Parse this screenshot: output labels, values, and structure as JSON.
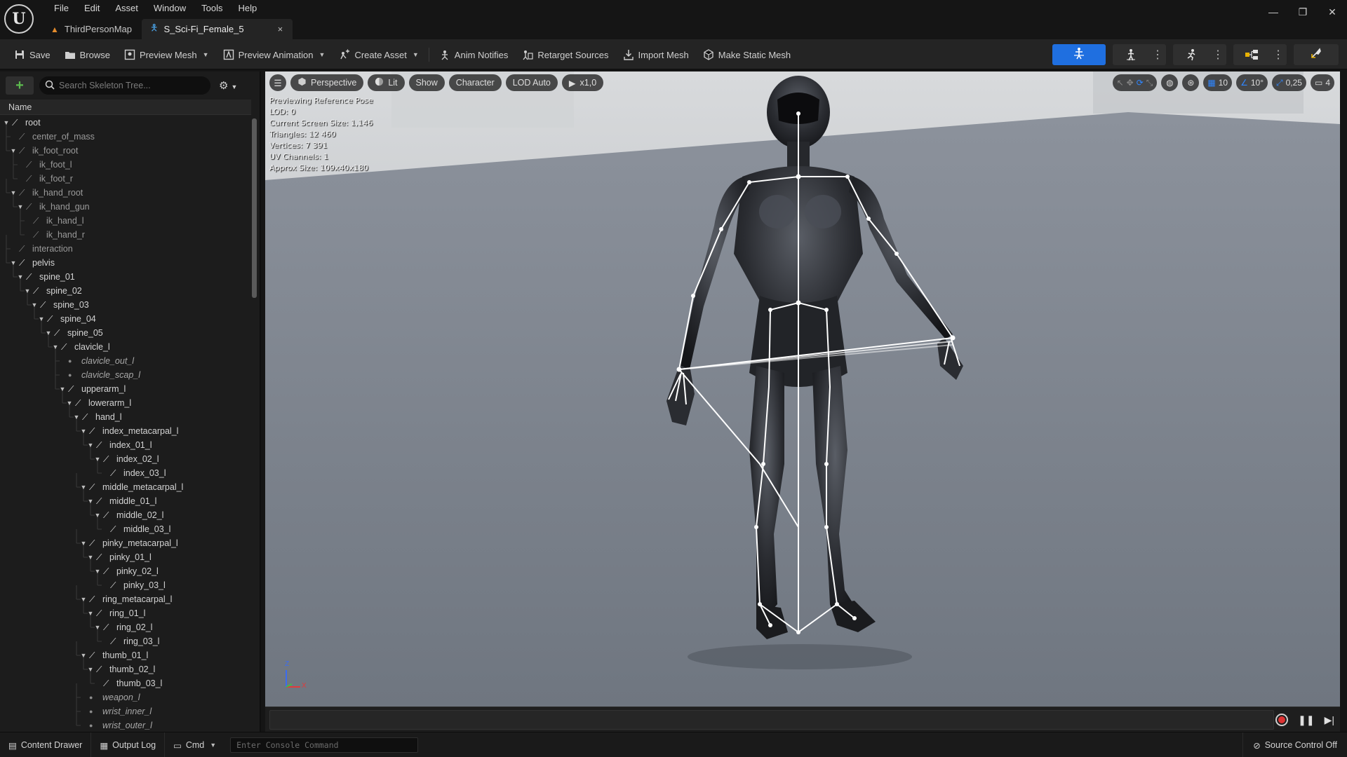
{
  "app": {
    "logo_letter": "U",
    "menu": [
      "File",
      "Edit",
      "Asset",
      "Window",
      "Tools",
      "Help"
    ],
    "window_controls": {
      "minimize": "—",
      "maximize": "❐",
      "close": "✕"
    }
  },
  "tabs": [
    {
      "label": "ThirdPersonMap",
      "icon": "level-icon"
    },
    {
      "label": "S_Sci-Fi_Female_5",
      "icon": "skeleton-icon",
      "close": "×"
    }
  ],
  "toolbar": {
    "save": "Save",
    "browse": "Browse",
    "preview_mesh": "Preview Mesh",
    "preview_animation": "Preview Animation",
    "create_asset": "Create Asset",
    "anim_notifies": "Anim Notifies",
    "retarget_sources": "Retarget Sources",
    "import_mesh": "Import Mesh",
    "make_static_mesh": "Make Static Mesh",
    "accent_color": "#1f6fe0"
  },
  "skeleton_tree": {
    "search_placeholder": "Search Skeleton Tree...",
    "column_header": "Name",
    "add_glyph": "+",
    "rows": [
      {
        "label": "root",
        "depth": 0,
        "kind": "bone",
        "expanded": true
      },
      {
        "label": "center_of_mass",
        "depth": 1,
        "kind": "dim",
        "expanded": null
      },
      {
        "label": "ik_foot_root",
        "depth": 1,
        "kind": "dim",
        "expanded": true
      },
      {
        "label": "ik_foot_l",
        "depth": 2,
        "kind": "dim",
        "expanded": null
      },
      {
        "label": "ik_foot_r",
        "depth": 2,
        "kind": "dim",
        "expanded": null
      },
      {
        "label": "ik_hand_root",
        "depth": 1,
        "kind": "dim",
        "expanded": true
      },
      {
        "label": "ik_hand_gun",
        "depth": 2,
        "kind": "dim",
        "expanded": true
      },
      {
        "label": "ik_hand_l",
        "depth": 3,
        "kind": "dim",
        "expanded": null
      },
      {
        "label": "ik_hand_r",
        "depth": 3,
        "kind": "dim",
        "expanded": null
      },
      {
        "label": "interaction",
        "depth": 1,
        "kind": "dim",
        "expanded": null
      },
      {
        "label": "pelvis",
        "depth": 1,
        "kind": "bone",
        "expanded": true
      },
      {
        "label": "spine_01",
        "depth": 2,
        "kind": "bone",
        "expanded": true
      },
      {
        "label": "spine_02",
        "depth": 3,
        "kind": "bone",
        "expanded": true
      },
      {
        "label": "spine_03",
        "depth": 4,
        "kind": "bone",
        "expanded": true
      },
      {
        "label": "spine_04",
        "depth": 5,
        "kind": "bone",
        "expanded": true
      },
      {
        "label": "spine_05",
        "depth": 6,
        "kind": "bone",
        "expanded": true
      },
      {
        "label": "clavicle_l",
        "depth": 7,
        "kind": "bone",
        "expanded": true
      },
      {
        "label": "clavicle_out_l",
        "depth": 8,
        "kind": "socket",
        "expanded": null
      },
      {
        "label": "clavicle_scap_l",
        "depth": 8,
        "kind": "socket",
        "expanded": null
      },
      {
        "label": "upperarm_l",
        "depth": 8,
        "kind": "bone",
        "expanded": true
      },
      {
        "label": "lowerarm_l",
        "depth": 9,
        "kind": "bone",
        "expanded": true
      },
      {
        "label": "hand_l",
        "depth": 10,
        "kind": "bone",
        "expanded": true
      },
      {
        "label": "index_metacarpal_l",
        "depth": 11,
        "kind": "bone",
        "expanded": true
      },
      {
        "label": "index_01_l",
        "depth": 12,
        "kind": "bone",
        "expanded": true
      },
      {
        "label": "index_02_l",
        "depth": 13,
        "kind": "bone",
        "expanded": true
      },
      {
        "label": "index_03_l",
        "depth": 14,
        "kind": "bone",
        "expanded": null
      },
      {
        "label": "middle_metacarpal_l",
        "depth": 11,
        "kind": "bone",
        "expanded": true
      },
      {
        "label": "middle_01_l",
        "depth": 12,
        "kind": "bone",
        "expanded": true
      },
      {
        "label": "middle_02_l",
        "depth": 13,
        "kind": "bone",
        "expanded": true
      },
      {
        "label": "middle_03_l",
        "depth": 14,
        "kind": "bone",
        "expanded": null
      },
      {
        "label": "pinky_metacarpal_l",
        "depth": 11,
        "kind": "bone",
        "expanded": true
      },
      {
        "label": "pinky_01_l",
        "depth": 12,
        "kind": "bone",
        "expanded": true
      },
      {
        "label": "pinky_02_l",
        "depth": 13,
        "kind": "bone",
        "expanded": true
      },
      {
        "label": "pinky_03_l",
        "depth": 14,
        "kind": "bone",
        "expanded": null
      },
      {
        "label": "ring_metacarpal_l",
        "depth": 11,
        "kind": "bone",
        "expanded": true
      },
      {
        "label": "ring_01_l",
        "depth": 12,
        "kind": "bone",
        "expanded": true
      },
      {
        "label": "ring_02_l",
        "depth": 13,
        "kind": "bone",
        "expanded": true
      },
      {
        "label": "ring_03_l",
        "depth": 14,
        "kind": "bone",
        "expanded": null
      },
      {
        "label": "thumb_01_l",
        "depth": 11,
        "kind": "bone",
        "expanded": true
      },
      {
        "label": "thumb_02_l",
        "depth": 12,
        "kind": "bone",
        "expanded": true
      },
      {
        "label": "thumb_03_l",
        "depth": 13,
        "kind": "bone",
        "expanded": null
      },
      {
        "label": "weapon_l",
        "depth": 11,
        "kind": "socket",
        "expanded": null
      },
      {
        "label": "wrist_inner_l",
        "depth": 11,
        "kind": "socket",
        "expanded": null
      },
      {
        "label": "wrist_outer_l",
        "depth": 11,
        "kind": "socket",
        "expanded": null
      }
    ]
  },
  "viewport": {
    "perspective": "Perspective",
    "lit": "Lit",
    "show": "Show",
    "character": "Character",
    "lod": "LOD Auto",
    "play_speed": "x1,0",
    "grid_snap": "10",
    "rotation_snap": "10°",
    "scale_snap": "0,25",
    "camera_speed": "4",
    "stats": [
      "Previewing Reference Pose",
      "LOD: 0",
      "Current Screen Size: 1,146",
      "Triangles: 12 460",
      "Vertices: 7 391",
      "UV Channels: 1",
      "Approx Size: 109x40x180"
    ],
    "axis_z": "Z",
    "axis_x": "X"
  },
  "statusbar": {
    "content_drawer": "Content Drawer",
    "output_log": "Output Log",
    "cmd": "Cmd",
    "console_placeholder": "Enter Console Command",
    "source_control": "Source Control Off"
  }
}
